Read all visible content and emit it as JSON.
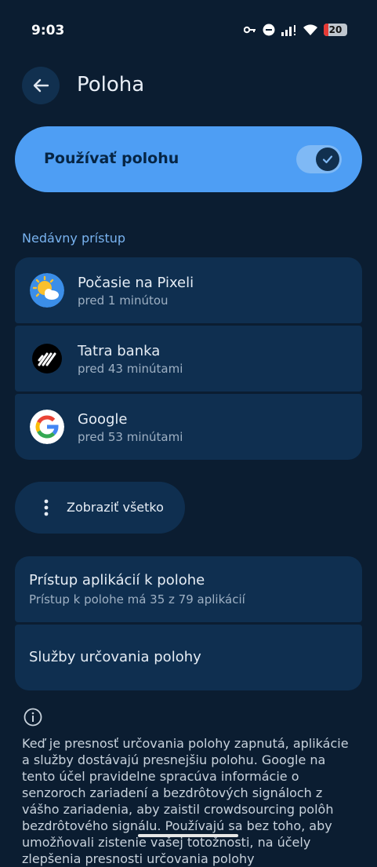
{
  "status_bar": {
    "time": "9:03",
    "battery": "20"
  },
  "header": {
    "title": "Poloha"
  },
  "location_toggle": {
    "label": "Používať polohu",
    "enabled": true
  },
  "recent": {
    "section_label": "Nedávny prístup",
    "apps": [
      {
        "name": "Počasie na Pixeli",
        "time": "pred 1 minútou",
        "icon": "weather-icon"
      },
      {
        "name": "Tatra banka",
        "time": "pred 43 minútami",
        "icon": "tatra-banka-icon"
      },
      {
        "name": "Google",
        "time": "pred 53 minútami",
        "icon": "google-icon"
      }
    ]
  },
  "show_all": {
    "label": "Zobraziť všetko"
  },
  "settings": {
    "app_access": {
      "title": "Prístup aplikácií k polohe",
      "subtitle": "Prístup k polohe má 35 z 79 aplikácií"
    },
    "location_services": {
      "title": "Služby určovania polohy"
    }
  },
  "info": {
    "text": "Keď je presnosť určovania polohy zapnutá, aplikácie a služby dostávajú presnejšiu polohu. Google na tento účel pravidelne spracúva informácie o senzoroch zariadení a bezdrôtových signáloch z vášho zariadenia, aby zaistil crowdsourcing polôh bezdrôtového signálu. Používajú sa bez toho, aby umožňovali zistenie vašej totožnosti, na účely zlepšenia presnosti určovania polohy"
  }
}
